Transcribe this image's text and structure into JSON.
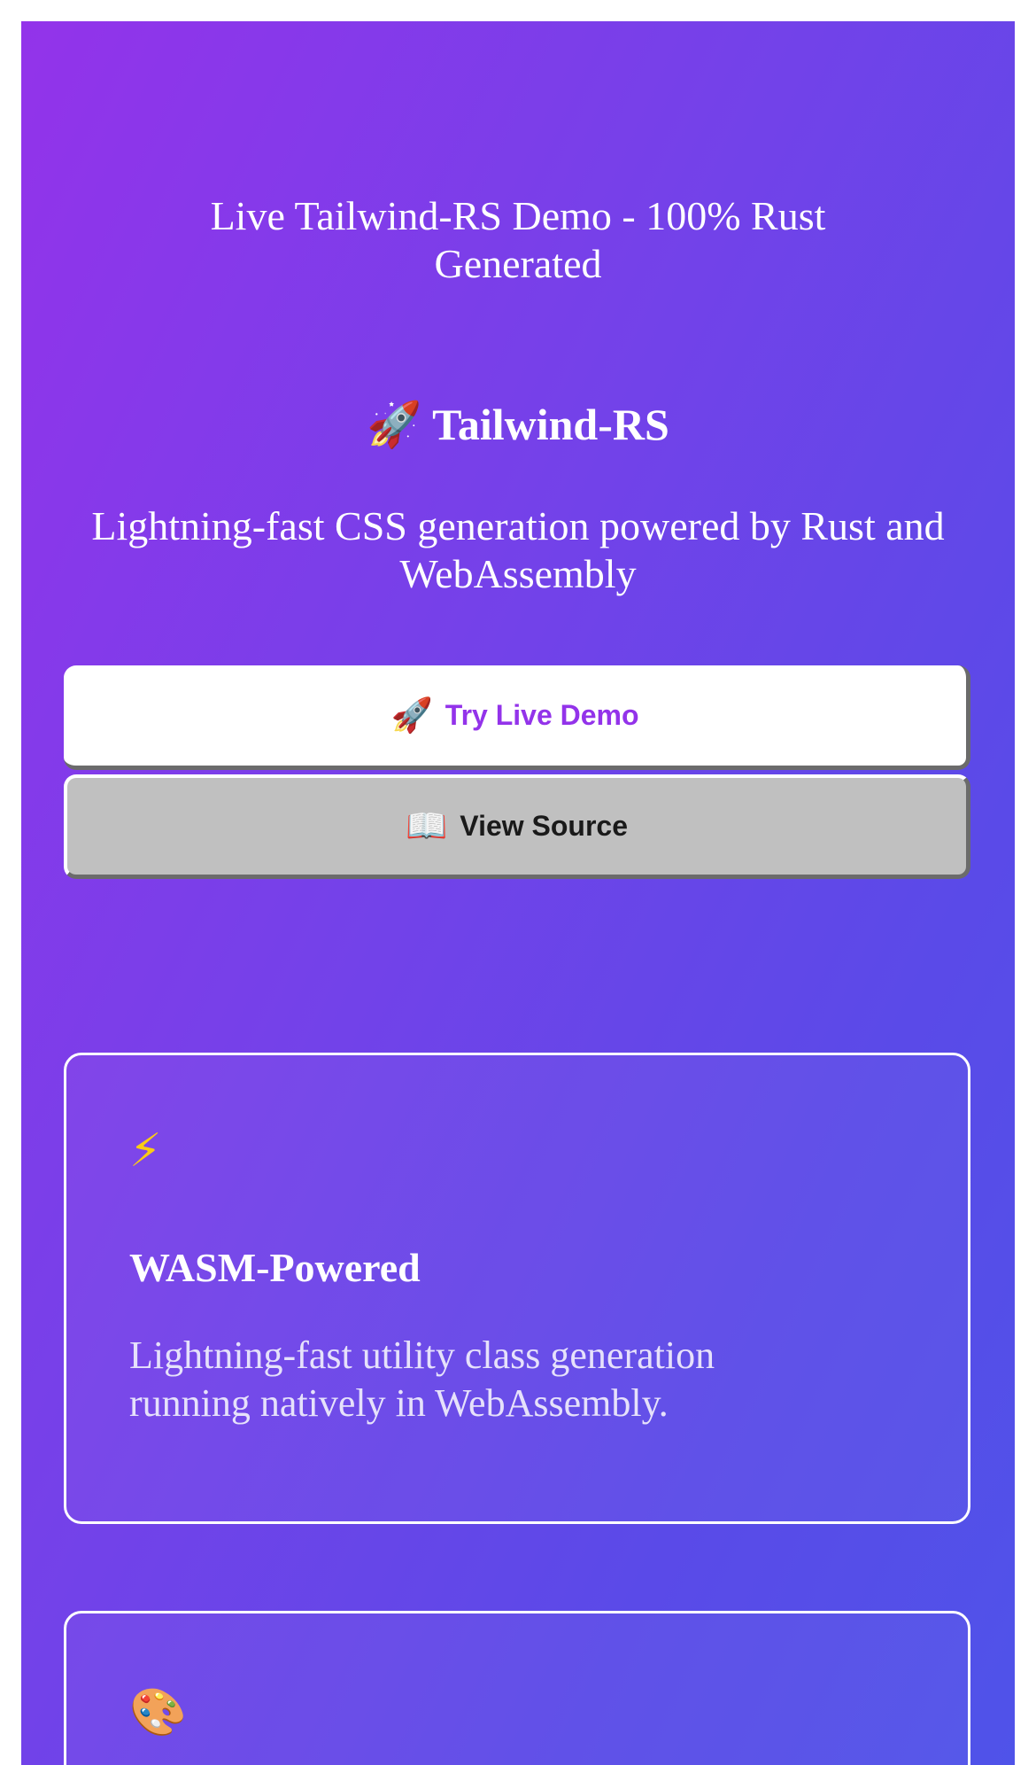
{
  "page": {
    "title": "Live Tailwind-RS Demo - 100% Rust Generated"
  },
  "hero": {
    "title_icon": "🚀",
    "title": "Tailwind-RS",
    "subtitle": "Lightning-fast CSS generation powered by Rust and WebAssembly"
  },
  "buttons": {
    "primary": {
      "icon": "🚀",
      "label": "Try Live Demo"
    },
    "secondary": {
      "icon": "📖",
      "label": "View Source"
    }
  },
  "features": [
    {
      "icon": "⚡",
      "icon_name": "lightning-icon",
      "title": "WASM-Powered",
      "description": "Lightning-fast utility class generation running natively in WebAssembly."
    },
    {
      "icon": "🎨",
      "icon_name": "palette-icon"
    }
  ],
  "colors": {
    "gradient_start": "#9333ea",
    "gradient_end": "#4f53e9",
    "primary_button_text": "#9333ea",
    "secondary_button_bg": "#c0c0c0"
  }
}
